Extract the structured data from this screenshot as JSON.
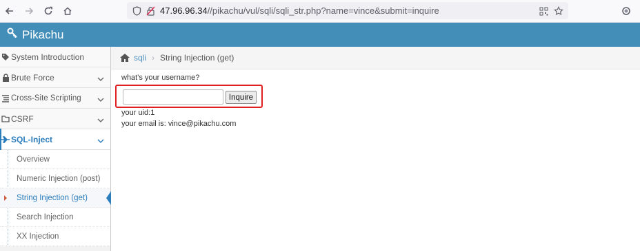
{
  "browser": {
    "url_host": "47.96.96.34",
    "url_path": "//pikachu/vul/sqli/sqli_str.php?name=vince&submit=inquire"
  },
  "header": {
    "brand": "Pikachu"
  },
  "sidebar": {
    "items": [
      {
        "label": "System Introduction",
        "icon": "tag-icon"
      },
      {
        "label": "Brute Force",
        "icon": "lock-icon"
      },
      {
        "label": "Cross-Site Scripting",
        "icon": "list-icon"
      },
      {
        "label": "CSRF",
        "icon": "folder-icon"
      },
      {
        "label": "SQL-Inject",
        "icon": "plane-icon"
      }
    ],
    "submenu": [
      {
        "label": "Overview"
      },
      {
        "label": "Numeric Injection (post)"
      },
      {
        "label": "String Injection (get)"
      },
      {
        "label": "Search Injection"
      },
      {
        "label": "XX Injection"
      }
    ]
  },
  "breadcrumb": {
    "link": "sqli",
    "current": "String Injection (get)"
  },
  "main": {
    "question": "what's your username?",
    "input_value": "",
    "submit_label": "Inquire",
    "result_uid": "your uid:1",
    "result_email": "your email is: vince@pikachu.com"
  },
  "colors": {
    "header": "#438eb9",
    "accent": "#2b7dbc",
    "highlight_box": "#e02020"
  }
}
